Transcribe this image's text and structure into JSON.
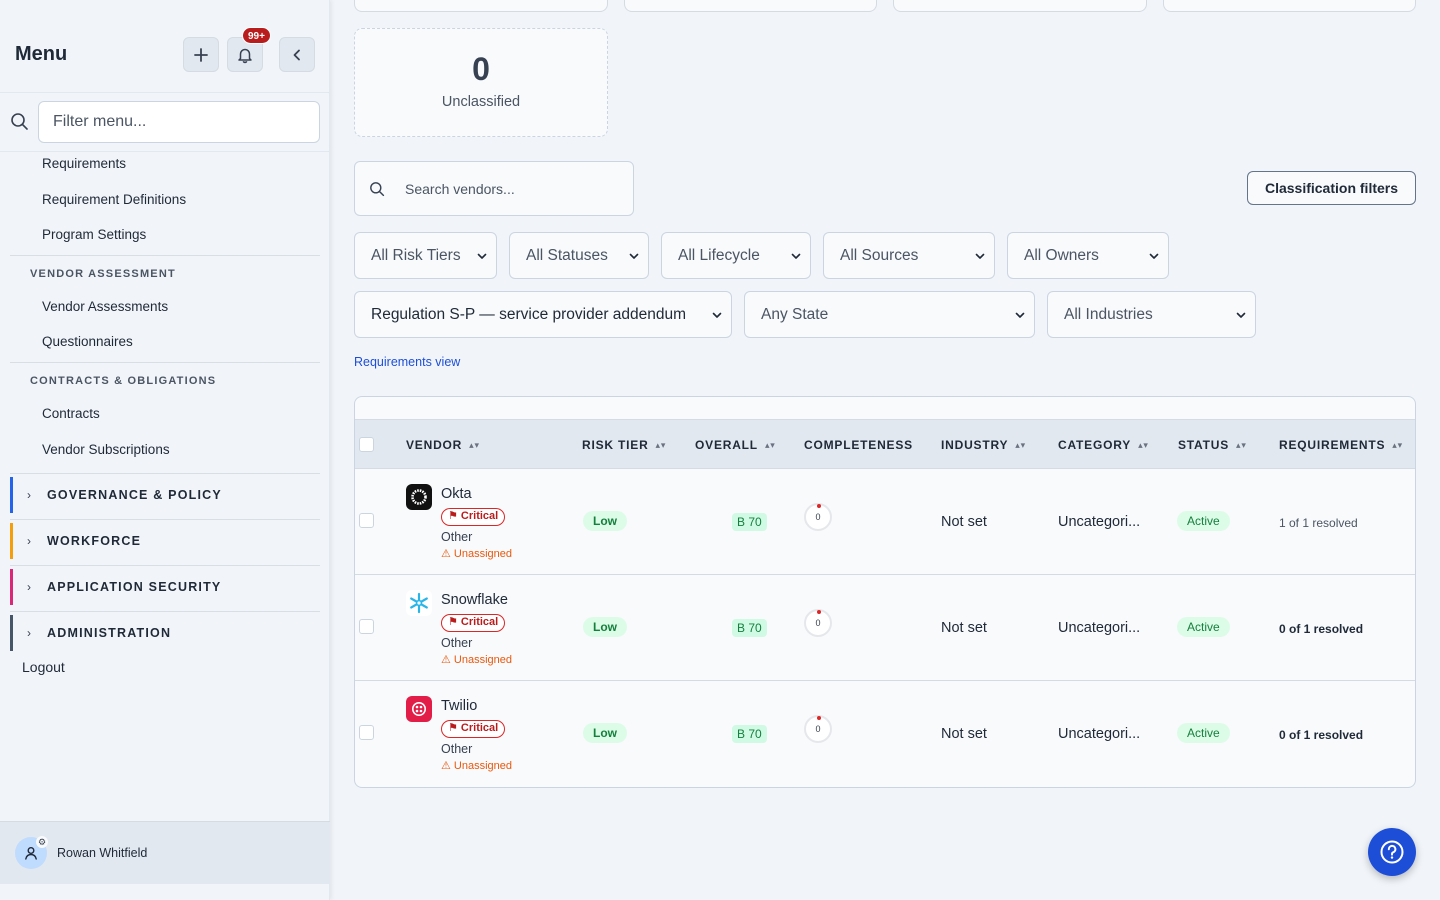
{
  "sidebar": {
    "title": "Menu",
    "notification_badge": "99+",
    "filter_placeholder": "Filter menu...",
    "items_top": [
      "Requirements",
      "Requirement Definitions",
      "Program Settings"
    ],
    "section_vendor": "VENDOR ASSESSMENT",
    "items_vendor": [
      "Vendor Assessments",
      "Questionnaires"
    ],
    "section_contracts": "CONTRACTS & OBLIGATIONS",
    "items_contracts": [
      "Contracts",
      "Vendor Subscriptions"
    ],
    "groups": [
      {
        "label": "GOVERNANCE & POLICY",
        "color": "#2563eb"
      },
      {
        "label": "WORKFORCE",
        "color": "#f59e0b"
      },
      {
        "label": "APPLICATION SECURITY",
        "color": "#db2777"
      },
      {
        "label": "ADMINISTRATION",
        "color": "#475569"
      }
    ],
    "logout": "Logout",
    "user_name": "Rowan Whitfield"
  },
  "summary": {
    "unclassified_count": "0",
    "unclassified_label": "Unclassified"
  },
  "search": {
    "placeholder": "Search vendors..."
  },
  "classification_filters_label": "Classification filters",
  "filters": {
    "risk_tiers": "All Risk Tiers",
    "statuses": "All Statuses",
    "lifecycle": "All Lifecycle",
    "sources": "All Sources",
    "owners": "All Owners",
    "regulation": "Regulation S-P — service provider addendum",
    "state": "Any State",
    "industries": "All Industries"
  },
  "requirements_view_link": "Requirements view",
  "table": {
    "headers": {
      "vendor": "VENDOR",
      "risk_tier": "RISK TIER",
      "overall": "OVERALL",
      "completeness": "COMPLETENESS",
      "industry": "INDUSTRY",
      "category": "CATEGORY",
      "status": "STATUS",
      "requirements": "REQUIREMENTS"
    },
    "rows": [
      {
        "name": "Okta",
        "criticality": "Critical",
        "category_tag": "Other",
        "owner": "⚠ Unassigned",
        "risk_tier": "Low",
        "overall": "B 70",
        "completeness": "0",
        "industry": "Not set",
        "category": "Uncategori...",
        "status": "Active",
        "requirements": "1 of 1 resolved",
        "logo": "okta-logo-icon"
      },
      {
        "name": "Snowflake",
        "criticality": "Critical",
        "category_tag": "Other",
        "owner": "⚠ Unassigned",
        "risk_tier": "Low",
        "overall": "B 70",
        "completeness": "0",
        "industry": "Not set",
        "category": "Uncategori...",
        "status": "Active",
        "requirements": "0 of 1 resolved",
        "logo": "snowflake-logo-icon"
      },
      {
        "name": "Twilio",
        "criticality": "Critical",
        "category_tag": "Other",
        "owner": "⚠ Unassigned",
        "risk_tier": "Low",
        "overall": "B 70",
        "completeness": "0",
        "industry": "Not set",
        "category": "Uncategori...",
        "status": "Active",
        "requirements": "0 of 1 resolved",
        "logo": "twilio-logo-icon"
      }
    ]
  },
  "colors": {
    "accent": "#1d4ed8",
    "critical": "#dc2626",
    "success": "#15803d",
    "warning": "#ea580c"
  }
}
